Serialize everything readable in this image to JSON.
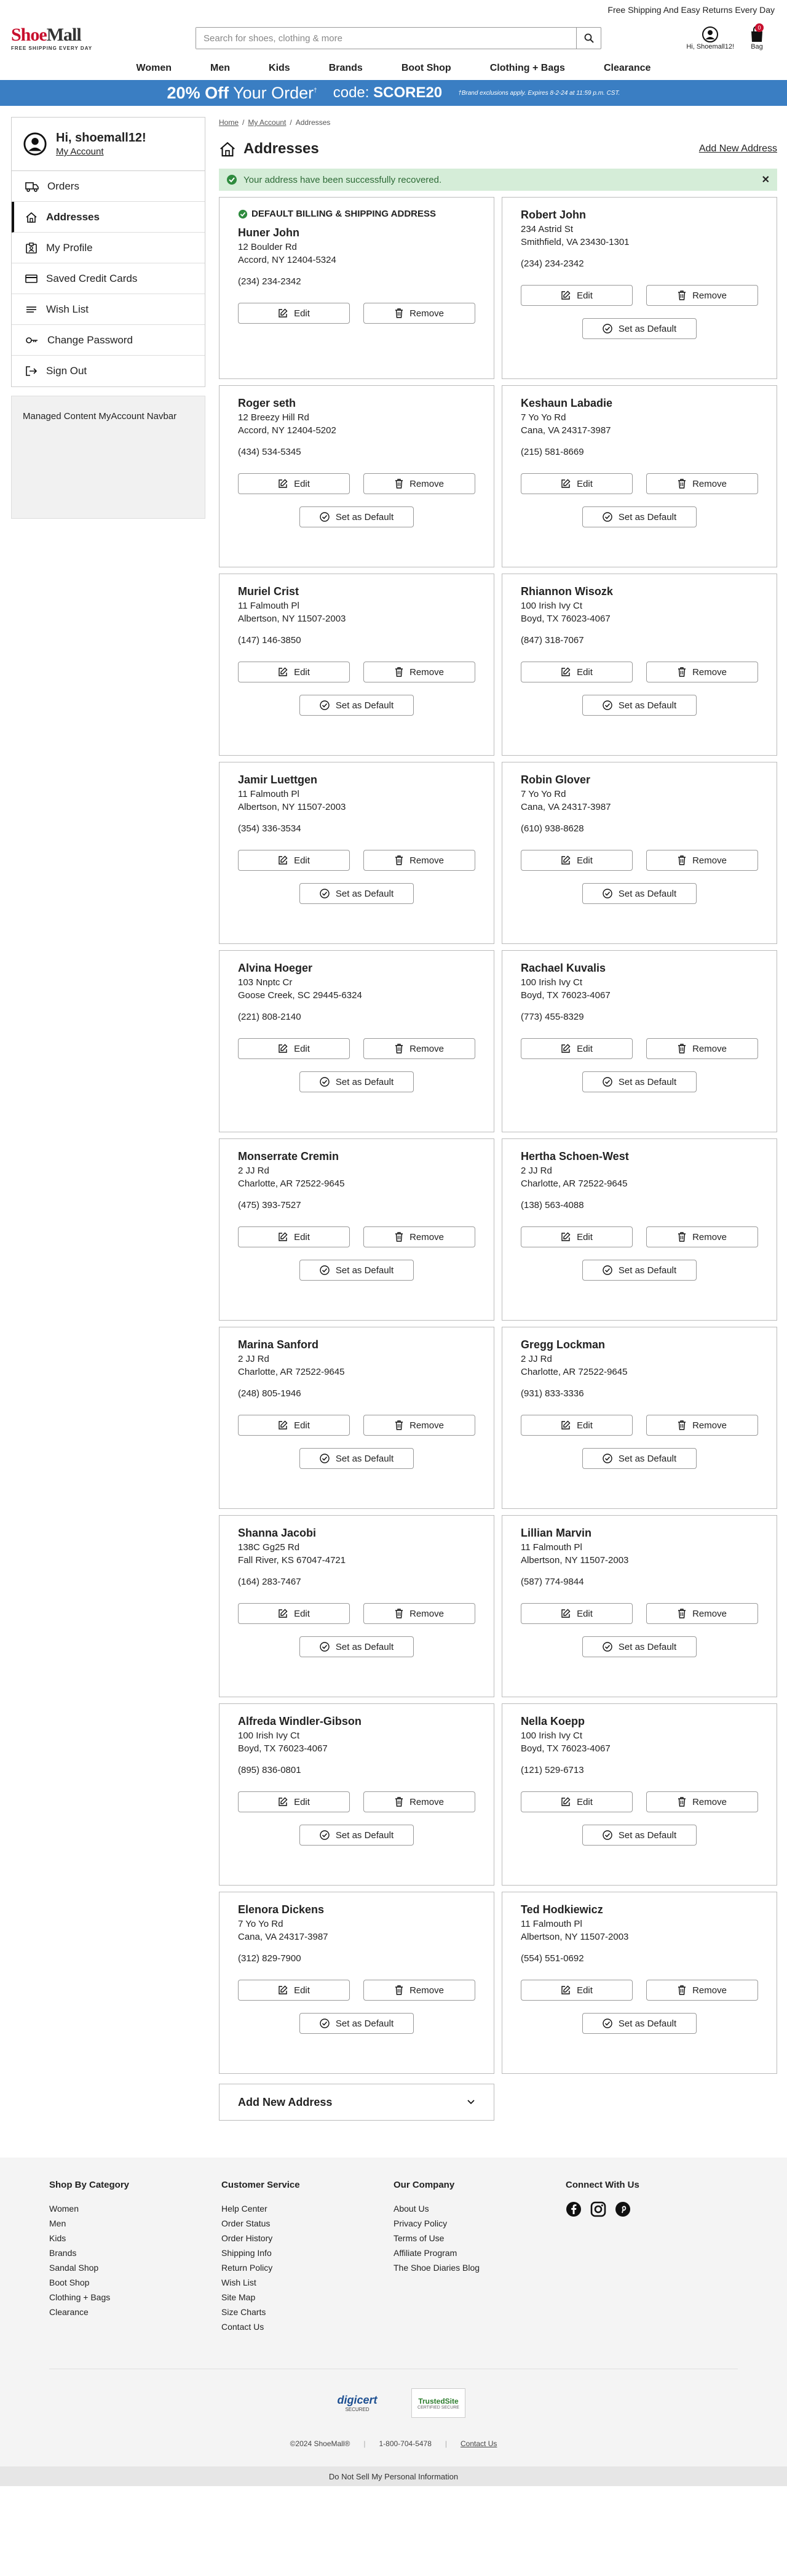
{
  "topbar": {
    "text": "Free Shipping And Easy Returns Every Day"
  },
  "logo": {
    "shoe": "Shoe",
    "mall": "Mall",
    "tagline": "FREE SHIPPING EVERY DAY"
  },
  "search": {
    "placeholder": "Search for shoes, clothing & more"
  },
  "header": {
    "account_label": "Hi, Shoemall12!",
    "bag_label": "Bag",
    "bag_count": "0"
  },
  "nav": [
    "Women",
    "Men",
    "Kids",
    "Brands",
    "Boot Shop",
    "Clothing + Bags",
    "Clearance"
  ],
  "promo": {
    "discount": "20% Off",
    "rest": " Your Order",
    "sup": "†",
    "code_label": "code: ",
    "code": "SCORE20",
    "fine": "†Brand exclusions apply. Expires 8-2-24 at 11:59 p.m. CST."
  },
  "sidebar": {
    "greeting": "Hi, shoemall12!",
    "my_account": "My Account",
    "items": [
      "Orders",
      "Addresses",
      "My Profile",
      "Saved Credit Cards",
      "Wish List",
      "Change Password",
      "Sign Out"
    ],
    "managed": "Managed Content MyAccount Navbar"
  },
  "breadcrumb": {
    "home": "Home",
    "sep": "/",
    "my_account": "My Account",
    "current": "Addresses"
  },
  "page": {
    "title": "Addresses",
    "add_new": "Add New Address"
  },
  "alert": {
    "message": "Your address have been successfully recovered.",
    "close": "✕"
  },
  "labels": {
    "default_tag": "DEFAULT BILLING & SHIPPING ADDRESS",
    "edit": "Edit",
    "remove": "Remove",
    "set_default": "Set as Default"
  },
  "addresses": [
    {
      "name": "Huner John",
      "street": "12 Boulder Rd",
      "city": "Accord, NY 12404-5324",
      "phone": "(234) 234-2342",
      "is_default": true
    },
    {
      "name": "Robert John",
      "street": "234 Astrid St",
      "city": "Smithfield, VA 23430-1301",
      "phone": "(234) 234-2342",
      "is_default": false
    },
    {
      "name": "Roger seth",
      "street": "12 Breezy Hill Rd",
      "city": "Accord, NY 12404-5202",
      "phone": "(434) 534-5345",
      "is_default": false
    },
    {
      "name": "Keshaun Labadie",
      "street": "7 Yo Yo Rd",
      "city": "Cana, VA 24317-3987",
      "phone": "(215) 581-8669",
      "is_default": false
    },
    {
      "name": "Muriel Crist",
      "street": "11 Falmouth Pl",
      "city": "Albertson, NY 11507-2003",
      "phone": "(147) 146-3850",
      "is_default": false
    },
    {
      "name": "Rhiannon Wisozk",
      "street": "100 Irish Ivy Ct",
      "city": "Boyd, TX 76023-4067",
      "phone": "(847) 318-7067",
      "is_default": false
    },
    {
      "name": "Jamir Luettgen",
      "street": "11 Falmouth Pl",
      "city": "Albertson, NY 11507-2003",
      "phone": "(354) 336-3534",
      "is_default": false
    },
    {
      "name": "Robin Glover",
      "street": "7 Yo Yo Rd",
      "city": "Cana, VA 24317-3987",
      "phone": "(610) 938-8628",
      "is_default": false
    },
    {
      "name": "Alvina Hoeger",
      "street": "103 Nnptc Cr",
      "city": "Goose Creek, SC 29445-6324",
      "phone": "(221) 808-2140",
      "is_default": false
    },
    {
      "name": "Rachael Kuvalis",
      "street": "100 Irish Ivy Ct",
      "city": "Boyd, TX 76023-4067",
      "phone": "(773) 455-8329",
      "is_default": false
    },
    {
      "name": "Monserrate Cremin",
      "street": "2 JJ Rd",
      "city": "Charlotte, AR 72522-9645",
      "phone": "(475) 393-7527",
      "is_default": false
    },
    {
      "name": "Hertha Schoen-West",
      "street": "2 JJ Rd",
      "city": "Charlotte, AR 72522-9645",
      "phone": "(138) 563-4088",
      "is_default": false
    },
    {
      "name": "Marina Sanford",
      "street": "2 JJ Rd",
      "city": "Charlotte, AR 72522-9645",
      "phone": "(248) 805-1946",
      "is_default": false
    },
    {
      "name": "Gregg Lockman",
      "street": "2 JJ Rd",
      "city": "Charlotte, AR 72522-9645",
      "phone": "(931) 833-3336",
      "is_default": false
    },
    {
      "name": "Shanna Jacobi",
      "street": "138C Gg25 Rd",
      "city": "Fall River, KS 67047-4721",
      "phone": "(164) 283-7467",
      "is_default": false
    },
    {
      "name": "Lillian Marvin",
      "street": "11 Falmouth Pl",
      "city": "Albertson, NY 11507-2003",
      "phone": "(587) 774-9844",
      "is_default": false
    },
    {
      "name": "Alfreda Windler-Gibson",
      "street": "100 Irish Ivy Ct",
      "city": "Boyd, TX 76023-4067",
      "phone": "(895) 836-0801",
      "is_default": false
    },
    {
      "name": "Nella Koepp",
      "street": "100 Irish Ivy Ct",
      "city": "Boyd, TX 76023-4067",
      "phone": "(121) 529-6713",
      "is_default": false
    },
    {
      "name": "Elenora Dickens",
      "street": "7 Yo Yo Rd",
      "city": "Cana, VA 24317-3987",
      "phone": "(312) 829-7900",
      "is_default": false
    },
    {
      "name": "Ted Hodkiewicz",
      "street": "11 Falmouth Pl",
      "city": "Albertson, NY 11507-2003",
      "phone": "(554) 551-0692",
      "is_default": false
    }
  ],
  "add_address": {
    "label": "Add New Address"
  },
  "footer": {
    "columns": [
      {
        "title": "Shop By Category",
        "links": [
          "Women",
          "Men",
          "Kids",
          "Brands",
          "Sandal Shop",
          "Boot Shop",
          "Clothing + Bags",
          "Clearance"
        ]
      },
      {
        "title": "Customer Service",
        "links": [
          "Help Center",
          "Order Status",
          "Order History",
          "Shipping Info",
          "Return Policy",
          "Wish List",
          "Site Map",
          "Size Charts",
          "Contact Us"
        ]
      },
      {
        "title": "Our Company",
        "links": [
          "About Us",
          "Privacy Policy",
          "Terms of Use",
          "Affiliate Program",
          "The Shoe Diaries Blog"
        ]
      }
    ],
    "connect_title": "Connect With Us",
    "social_icons": [
      "facebook-icon",
      "instagram-icon",
      "pinterest-icon"
    ],
    "digicert": "digicert",
    "digicert_sub": "SECURED",
    "trustedsite": "TrustedSite",
    "trustedsite_sub": "CERTIFIED SECURE",
    "copyright": "©2024 ShoeMall®",
    "phone": "1-800-704-5478",
    "contact": "Contact Us",
    "bottom": "Do Not Sell My Personal Information"
  },
  "colors": {
    "promo_blue": "#3a7ec3",
    "brand_red": "#c8102e",
    "alert_green": "#d5edd8"
  }
}
